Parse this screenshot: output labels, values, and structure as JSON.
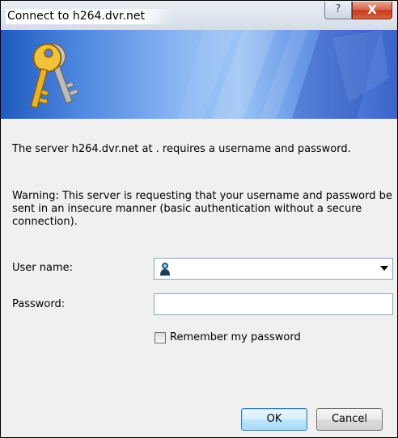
{
  "window": {
    "title": "Connect to h264.dvr.net",
    "help_label": "?",
    "close_label": "X"
  },
  "message": {
    "server_text": "The server h264.dvr.net at . requires a username and password.",
    "warning_text": "Warning: This server is requesting that your username and password be sent in an insecure manner (basic authentication without a secure connection)."
  },
  "form": {
    "username_label": "User name:",
    "username_value": "",
    "password_label": "Password:",
    "password_value": "",
    "remember_label": "Remember my password",
    "remember_checked": false
  },
  "buttons": {
    "ok_label": "OK",
    "cancel_label": "Cancel"
  },
  "icons": {
    "banner": "keys-icon",
    "user": "user-account-icon"
  },
  "colors": {
    "banner_blue": "#4f88e0",
    "close_red": "#c8381b",
    "window_bg": "#f0f0f0"
  }
}
